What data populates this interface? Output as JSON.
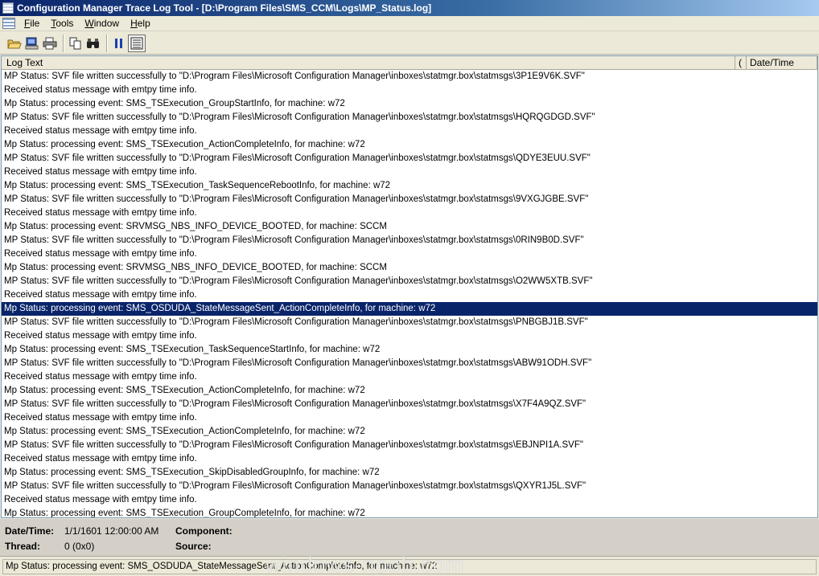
{
  "window": {
    "title": "Configuration Manager Trace Log Tool - [D:\\Program Files\\SMS_CCM\\Logs\\MP_Status.log]"
  },
  "menu": [
    {
      "u": "F",
      "rest": "ile"
    },
    {
      "u": "T",
      "rest": "ools"
    },
    {
      "u": "W",
      "rest": "indow"
    },
    {
      "u": "H",
      "rest": "elp"
    }
  ],
  "toolbar": {
    "icons": [
      "open-icon",
      "open-server-icon",
      "print-icon",
      "copy-icon",
      "find-icon",
      "pause-icon",
      "highlight-icon"
    ]
  },
  "columns": {
    "log_text": "Log Text",
    "component": "(",
    "date_time": "Date/Time"
  },
  "rows": [
    "MP Status: SVF file written successfully to \"D:\\Program Files\\Microsoft Configuration Manager\\inboxes\\statmgr.box\\statmsgs\\3P1E9V6K.SVF\"",
    "Received status message with emtpy time info.",
    "Mp Status: processing event: SMS_TSExecution_GroupStartInfo, for machine: w72",
    "MP Status: SVF file written successfully to \"D:\\Program Files\\Microsoft Configuration Manager\\inboxes\\statmgr.box\\statmsgs\\HQRQGDGD.SVF\"",
    "Received status message with emtpy time info.",
    "Mp Status: processing event: SMS_TSExecution_ActionCompleteInfo, for machine: w72",
    "MP Status: SVF file written successfully to \"D:\\Program Files\\Microsoft Configuration Manager\\inboxes\\statmgr.box\\statmsgs\\QDYE3EUU.SVF\"",
    "Received status message with emtpy time info.",
    "Mp Status: processing event: SMS_TSExecution_TaskSequenceRebootInfo, for machine: w72",
    "MP Status: SVF file written successfully to \"D:\\Program Files\\Microsoft Configuration Manager\\inboxes\\statmgr.box\\statmsgs\\9VXGJGBE.SVF\"",
    "Received status message with emtpy time info.",
    "Mp Status: processing event: SRVMSG_NBS_INFO_DEVICE_BOOTED, for machine: SCCM",
    "MP Status: SVF file written successfully to \"D:\\Program Files\\Microsoft Configuration Manager\\inboxes\\statmgr.box\\statmsgs\\0RIN9B0D.SVF\"",
    "Received status message with emtpy time info.",
    "Mp Status: processing event: SRVMSG_NBS_INFO_DEVICE_BOOTED, for machine: SCCM",
    "MP Status: SVF file written successfully to \"D:\\Program Files\\Microsoft Configuration Manager\\inboxes\\statmgr.box\\statmsgs\\O2WW5XTB.SVF\"",
    "Received status message with emtpy time info.",
    "Mp Status: processing event: SMS_OSDUDA_StateMessageSent_ActionCompleteInfo, for machine: w72",
    "MP Status: SVF file written successfully to \"D:\\Program Files\\Microsoft Configuration Manager\\inboxes\\statmgr.box\\statmsgs\\PNBGBJ1B.SVF\"",
    "Received status message with emtpy time info.",
    "Mp Status: processing event: SMS_TSExecution_TaskSequenceStartInfo, for machine: w72",
    "MP Status: SVF file written successfully to \"D:\\Program Files\\Microsoft Configuration Manager\\inboxes\\statmgr.box\\statmsgs\\ABW91ODH.SVF\"",
    "Received status message with emtpy time info.",
    "Mp Status: processing event: SMS_TSExecution_ActionCompleteInfo, for machine: w72",
    "MP Status: SVF file written successfully to \"D:\\Program Files\\Microsoft Configuration Manager\\inboxes\\statmgr.box\\statmsgs\\X7F4A9QZ.SVF\"",
    "Received status message with emtpy time info.",
    "Mp Status: processing event: SMS_TSExecution_ActionCompleteInfo, for machine: w72",
    "MP Status: SVF file written successfully to \"D:\\Program Files\\Microsoft Configuration Manager\\inboxes\\statmgr.box\\statmsgs\\EBJNPI1A.SVF\"",
    "Received status message with emtpy time info.",
    "Mp Status: processing event: SMS_TSExecution_SkipDisabledGroupInfo, for machine: w72",
    "MP Status: SVF file written successfully to \"D:\\Program Files\\Microsoft Configuration Manager\\inboxes\\statmgr.box\\statmsgs\\QXYR1J5L.SVF\"",
    "Received status message with emtpy time info.",
    "Mp Status: processing event: SMS_TSExecution_GroupCompleteInfo, for machine: w72"
  ],
  "selected_row": 17,
  "details": {
    "datetime_label": "Date/Time:",
    "datetime_value": "1/1/1601 12:00:00 AM",
    "component_label": "Component:",
    "component_value": "",
    "thread_label": "Thread:",
    "thread_value": "0 (0x0)",
    "source_label": "Source:",
    "source_value": ""
  },
  "status_message": "Mp Status: processing event: SMS_OSDUDA_StateMessageSent_ActionCompleteInfo, for machine: w72",
  "watermark": "windows-noob.com",
  "colors": {
    "selection": "#0a246a",
    "title_start": "#0a246a",
    "title_end": "#a6caf0"
  }
}
